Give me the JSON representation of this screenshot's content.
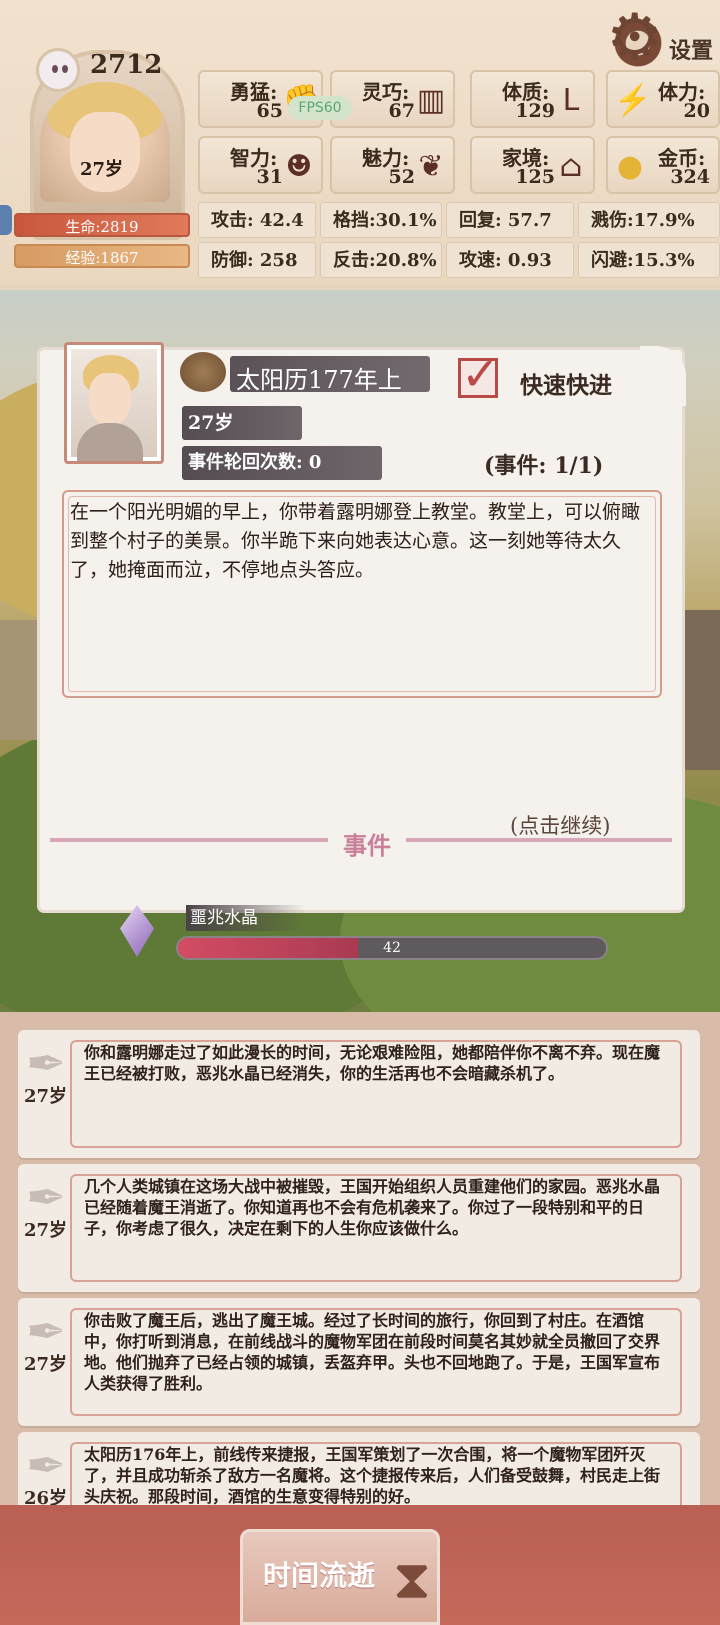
{
  "header": {
    "settings_label": "设置",
    "score": "2712",
    "age": "27岁",
    "life": "生命:2819",
    "exp": "经验:1867",
    "fps": "FPS60"
  },
  "stats": [
    {
      "label": "勇猛:",
      "value": "65",
      "icon": "fist-icon"
    },
    {
      "label": "灵巧:",
      "value": "67",
      "icon": "cloak-icon"
    },
    {
      "label": "体质:",
      "value": "129",
      "icon": "arm-icon"
    },
    {
      "label": "体力:",
      "value": "20",
      "icon": "lightning-icon"
    },
    {
      "label": "智力:",
      "value": "31",
      "icon": "brain-icon"
    },
    {
      "label": "魅力:",
      "value": "52",
      "icon": "rose-icon"
    },
    {
      "label": "家境:",
      "value": "125",
      "icon": "house-icon"
    },
    {
      "label": "金币:",
      "value": "324",
      "icon": "coin-icon"
    }
  ],
  "combat": [
    "攻击: 42.4",
    "格挡:30.1%",
    "回复:  57.7",
    "溅伤:17.9%",
    "防御:  258",
    "反击:20.8%",
    "攻速:  0.93",
    "闪避:15.3%"
  ],
  "event": {
    "date": "太阳历177年上",
    "quick_label": "快速快进",
    "age": "27岁",
    "cycle": "事件轮回次数: 0",
    "count": "(事件: 1/1)",
    "story": "在一个阳光明媚的早上，你带着露明娜登上教堂。教堂上，可以俯瞰到整个村子的美景。你半跪下来向她表达心意。这一刻她等待太久了，她掩面而泣，不停地点头答应。",
    "continue": "(点击继续)",
    "title": "事件"
  },
  "crystal": {
    "name": "噩兆水晶",
    "value": "42",
    "fill": 0.42
  },
  "log": [
    {
      "age": "27岁",
      "text": "你和露明娜走过了如此漫长的时间，无论艰难险阻，她都陪伴你不离不弃。现在魔王已经被打败，恶兆水晶已经消失，你的生活再也不会暗藏杀机了。"
    },
    {
      "age": "27岁",
      "text": "几个人类城镇在这场大战中被摧毁，王国开始组织人员重建他们的家园。恶兆水晶已经随着魔王消逝了。你知道再也不会有危机袭来了。你过了一段特别和平的日子，你考虑了很久，决定在剩下的人生你应该做什么。"
    },
    {
      "age": "27岁",
      "text": "你击败了魔王后，逃出了魔王城。经过了长时间的旅行，你回到了村庄。在酒馆中，你打听到消息，在前线战斗的魔物军团在前段时间莫名其妙就全员撤回了交界地。他们抛弃了已经占领的城镇，丢盔弃甲。头也不回地跑了。于是，王国军宣布人类获得了胜利。"
    },
    {
      "age": "26岁",
      "text": "太阳历176年上，前线传来捷报，王国军策划了一次合围，将一个魔物军团歼灭了，并且成功斩杀了敌方一名魔将。这个捷报传来后，人们备受鼓舞，村民走上街头庆祝。那段时间，酒馆的生意变得特别的好。"
    }
  ],
  "footer": {
    "time_label": "时间流逝"
  }
}
